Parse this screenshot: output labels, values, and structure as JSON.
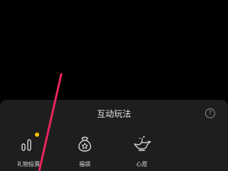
{
  "panel": {
    "title": "互动玩法",
    "help_glyph": "?"
  },
  "items": [
    {
      "label": "礼物投票",
      "icon": "bar-chart-icon",
      "badge": "notification-dot"
    },
    {
      "label": "福袋",
      "icon": "lucky-bag-icon"
    },
    {
      "label": "心愿",
      "icon": "magic-lamp-icon"
    }
  ],
  "colors": {
    "background": "#000000",
    "panel": "#1e1e1e",
    "text": "#e6e6e6",
    "badge": "#f5c400",
    "stroke_annotation": "#e8245c"
  }
}
